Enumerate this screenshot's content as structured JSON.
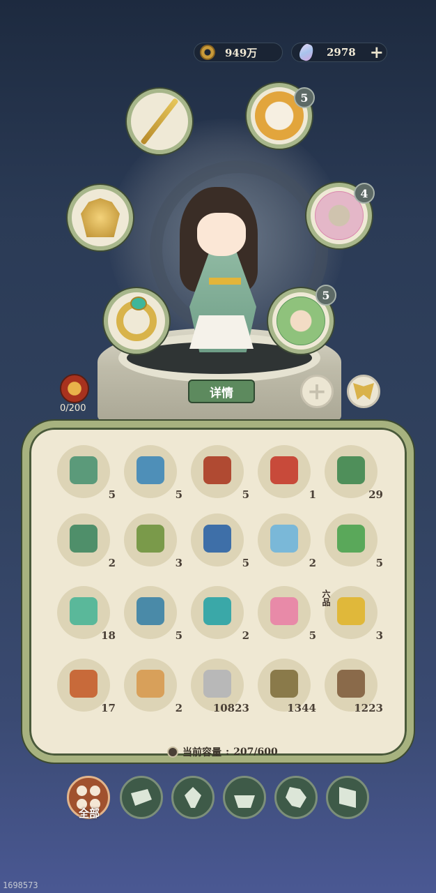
{
  "currency": {
    "coins": "949万",
    "gems": "2978"
  },
  "equipment_badges": {
    "top_right": "5",
    "mid_right": "4",
    "low_right": "5"
  },
  "details_button": "详情",
  "monster_counter": "0/200",
  "inventory": {
    "items": [
      {
        "qty": "5",
        "color": "#5b9a7a"
      },
      {
        "qty": "5",
        "color": "#4e8fb8"
      },
      {
        "qty": "5",
        "color": "#b04a32"
      },
      {
        "qty": "1",
        "color": "#c84a3a"
      },
      {
        "qty": "29",
        "color": "#4f8f5a"
      },
      {
        "qty": "2",
        "color": "#4f8f6a"
      },
      {
        "qty": "3",
        "color": "#7a9a4a"
      },
      {
        "qty": "5",
        "color": "#3e6fa8"
      },
      {
        "qty": "2",
        "color": "#7ab8d8"
      },
      {
        "qty": "5",
        "color": "#5aa85a"
      },
      {
        "qty": "18",
        "color": "#5ab89a"
      },
      {
        "qty": "5",
        "color": "#4a8aa8"
      },
      {
        "qty": "2",
        "color": "#3aa8a8"
      },
      {
        "qty": "5",
        "color": "#e88aa8"
      },
      {
        "qty": "3",
        "color": "#e0b83a"
      },
      {
        "qty": "17",
        "color": "#c86a3a"
      },
      {
        "qty": "2",
        "color": "#d8a05a"
      },
      {
        "qty": "10823",
        "color": "#b8b8b8"
      },
      {
        "qty": "1344",
        "color": "#8a7a4a"
      },
      {
        "qty": "1223",
        "color": "#8a6a4a"
      }
    ],
    "grade_label": "六品",
    "capacity_label": "当前容量",
    "capacity_value": "207/600"
  },
  "tabs": {
    "all_label": "全部"
  },
  "footer_id": "1698573"
}
